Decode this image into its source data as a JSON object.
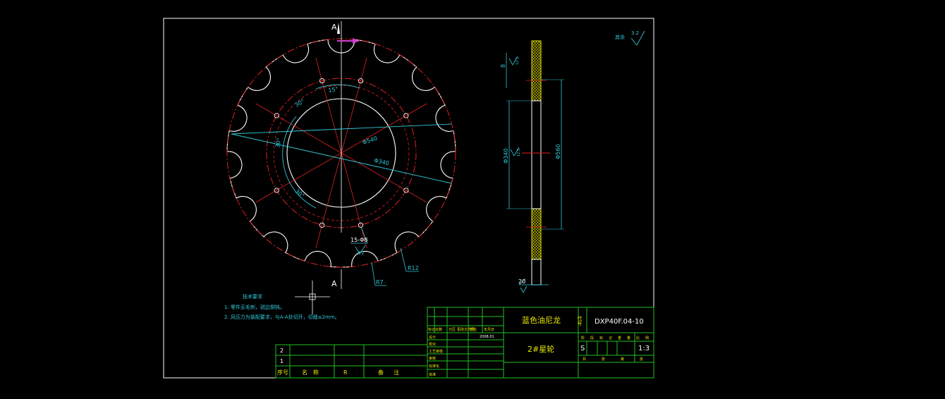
{
  "drawing": {
    "section_label": "A",
    "roughness_note": "其余",
    "roughness_value": "3.2",
    "dimensions": {
      "angle": "15°",
      "arc_upper": "30°",
      "arc_left": "30°",
      "arc_lower": "30°",
      "dia_pitch": "Φ540",
      "dia_bore": "Φ340",
      "holes": "15-Φ8",
      "hole_roughness": "3.2",
      "r_tooth_1": "R7",
      "r_tooth_2": "R12",
      "side_height_top": "8",
      "side_inner": "Φ340",
      "side_outer": "Φ560",
      "side_thickness": "20",
      "side_ra_1": "12.5",
      "side_ra_2": "12.5"
    },
    "tech_title": "技术要求",
    "tech_notes": [
      "1. 零件无毛刺，锐边倒钝。",
      "2. 风压力为装配要求，与A-A处切开，切缝≤2mm。"
    ]
  },
  "parts_list": {
    "rows": [
      "2",
      "1"
    ],
    "headers": [
      "序号",
      "名称",
      "R",
      "备注"
    ]
  },
  "title_block": {
    "material": "蓝色油尼龙",
    "part_name": "2#星轮",
    "code_label": "代号",
    "drawing_no": "DXP40F.04-10",
    "stage": "S",
    "scale": "1:3",
    "sheet_labels": [
      "共",
      "张",
      "第",
      "张"
    ],
    "weight_labels": [
      "阶",
      "段",
      "标",
      "记",
      "重",
      "量",
      "比",
      "例"
    ],
    "date": "2008.01",
    "revision_headers": [
      "标记",
      "处数",
      "分区",
      "更改文件号",
      "签名",
      "年月日"
    ],
    "sign_rows": [
      "设计",
      "校对",
      "工艺审核",
      "审核",
      "标准化",
      "批准"
    ]
  }
}
